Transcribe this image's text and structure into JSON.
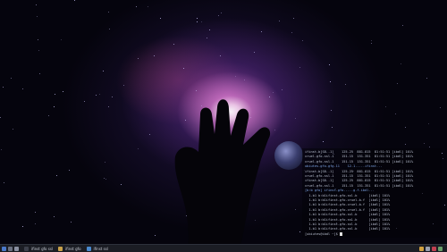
{
  "desktop": {
    "wallpaper": "nebula-hand",
    "accent": "#c070e0"
  },
  "terminal": {
    "lines": [
      "ifinst-b[S8..1]    125.25  881.815  81:51:51 [ibdl] 101%",
      "cruel-gfo-ssl.1    151.15  151.351  81:51:51 [ibdl] 101%",
      "cruel-gfo-ssl.1    151.15  151.351  81:51:51 [ibdl] 101%",
      "ubiutes-gfo-gfg.11    12.1.....ifinst...",
      "ifinst-b[S8..1]    125.25  881.815  81:51:51 [ibdl] 101%",
      "cruel-gfo-ssl.1    151.15  151.351  81:51:51 [ibdl] 101%",
      "ifinst-b[S8..1]    125.25  881.815  81:51:51 [ibdl] 101%",
      "cruel-gfo-ssl.1    151.15  151.351  81:51:51 [ibdl] 101%",
      "[b:b gfo] ifinst-gfo.....g.f.ibdl...",
      "  1.b1 b:b1ifinst-gfo-ssl.b      [ibdl] 101%",
      "  1.b1 b:b1ifinst-gfo-cruel-b.f  [ibdl] 101%",
      "  1.b1 b:b1ifinst-gfo-cruel-b.f  [ibdl] 101%",
      "  1.b1 b:b1ifinst-gfo-cruel-b.f  [ibdl] 101%",
      "  1.b1 b:b1ifinst-gfo-ssl.b      [ibdl] 101%",
      "  1.b1 b:b1ifinst-gfo-ssl.b      [ibdl] 101%",
      "  1.b1 b:b1ifinst-gfo-ssl.b      [ibdl] 101%",
      "  1.b1 b:b1ifinst-gfo-ssl.b      [ibdl] 101%",
      "[ubiutes@ibdl ~]$ "
    ]
  },
  "taskbar": {
    "tasks": [
      {
        "label": "ifinst gfo ssl",
        "icon": "terminal-icon"
      },
      {
        "label": "ifinst gfo",
        "icon": "folder-icon"
      },
      {
        "label": "ifinst ssl",
        "icon": "browser-icon"
      }
    ],
    "tray_icons": [
      "network-icon",
      "volume-icon",
      "flag-icon",
      "battery-icon"
    ],
    "clock": ""
  }
}
